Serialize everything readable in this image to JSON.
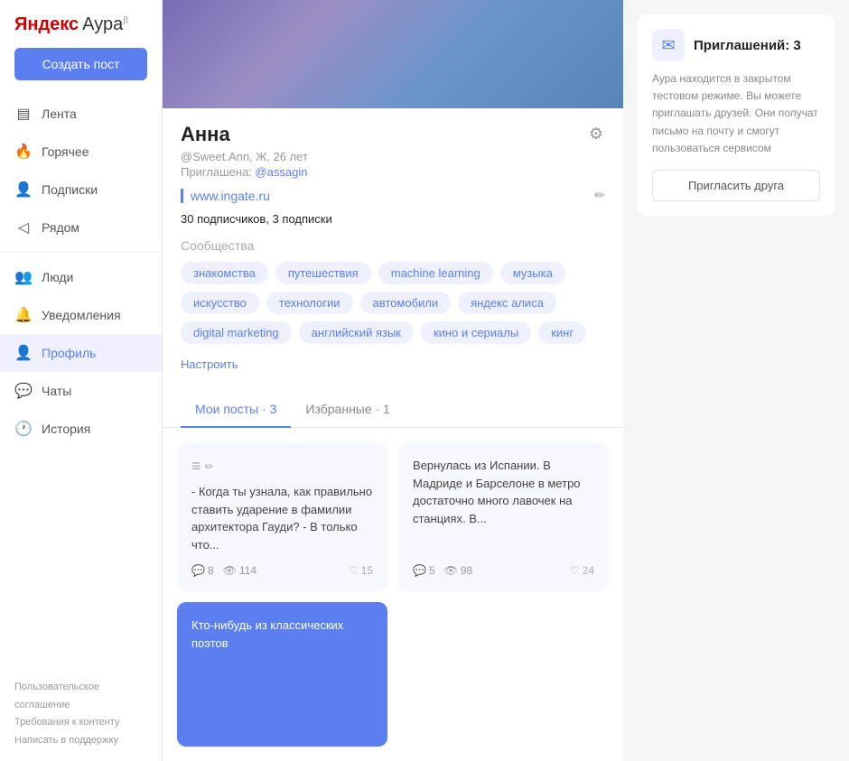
{
  "logo": {
    "yandex": "Яндекс",
    "aura": "Аура",
    "beta": "β"
  },
  "sidebar": {
    "create_btn": "Создать пост",
    "items": [
      {
        "id": "feed",
        "label": "Лента",
        "icon": "▤"
      },
      {
        "id": "hot",
        "label": "Горячее",
        "icon": "🔥"
      },
      {
        "id": "subscriptions",
        "label": "Подписки",
        "icon": "👤"
      },
      {
        "id": "nearby",
        "label": "Рядом",
        "icon": "◁"
      },
      {
        "id": "people",
        "label": "Люди",
        "icon": "👥"
      },
      {
        "id": "notifications",
        "label": "Уведомления",
        "icon": "🔔"
      },
      {
        "id": "profile",
        "label": "Профиль",
        "icon": "👤",
        "active": true
      },
      {
        "id": "chats",
        "label": "Чаты",
        "icon": "💬"
      },
      {
        "id": "history",
        "label": "История",
        "icon": "🕐"
      }
    ],
    "footer": {
      "links": [
        "Пользовательское соглашение",
        "Требования к контенту",
        "Написать в поддержку"
      ]
    }
  },
  "profile": {
    "name": "Анна",
    "meta": "@Sweet.Ann, Ж, 26 лет",
    "invited_label": "Приглашена:",
    "invited_by": "@assagin",
    "website": "www.ingate.ru",
    "subscribers_count": "30",
    "subscribers_label": "подписчиков,",
    "subscriptions_count": "3",
    "subscriptions_label": "подписки",
    "communities_label": "Сообщества",
    "tags": [
      "знакомства",
      "путешествия",
      "machine learning",
      "музыка",
      "искусство",
      "технологии",
      "автомобили",
      "яндекс алиса",
      "digital marketing",
      "английский язык",
      "кино и сериалы",
      "кинг"
    ],
    "settings_link": "Настроить"
  },
  "tabs": {
    "my_posts": "Мои посты",
    "my_posts_count": "3",
    "favorites": "Избранные",
    "favorites_count": "1"
  },
  "posts": [
    {
      "id": 1,
      "text": "- Когда ты узнала, как правильно ставить ударение в фамилии архитектора Гауди? - В только что...",
      "comments": "8",
      "views": "114",
      "likes": "15",
      "has_edit_icon": true,
      "blue": false
    },
    {
      "id": 2,
      "text": "Вернулась из Испании. В Мадриде и Барселоне в метро достаточно много лавочек на станциях. В...",
      "comments": "5",
      "views": "98",
      "likes": "24",
      "has_edit_icon": false,
      "blue": false
    },
    {
      "id": 3,
      "text": "Кто-нибудь из классических поэтов",
      "comments": "",
      "views": "",
      "likes": "",
      "has_edit_icon": false,
      "blue": true
    }
  ],
  "right_panel": {
    "mail_icon": "✉",
    "invites_label": "Приглашений: 3",
    "description": "Аура находится в закрытом тестовом режиме. Вы можете приглашать друзей. Они получат письмо на почту и смогут пользоваться сервисом",
    "invite_btn": "Пригласить друга"
  },
  "icons": {
    "gear": "⚙",
    "edit_pencil": "✏",
    "comment": "💬",
    "eye": "👁",
    "heart": "♡",
    "edit_lines": "≡"
  }
}
